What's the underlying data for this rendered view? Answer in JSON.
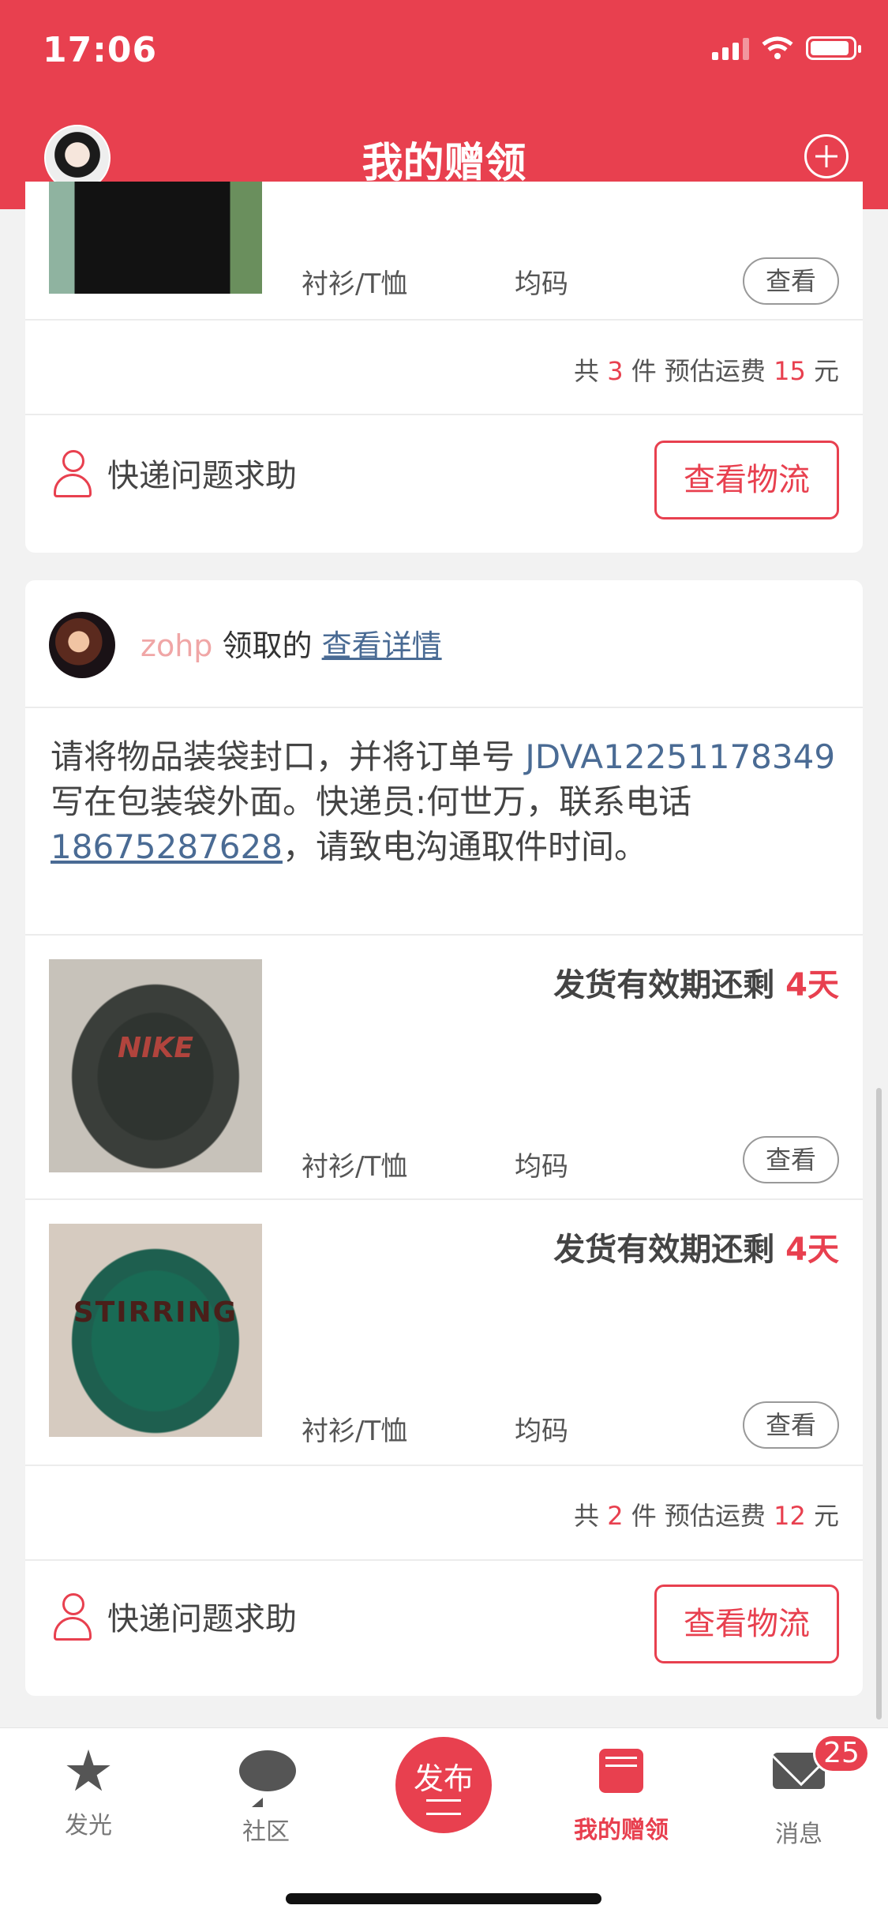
{
  "status_bar": {
    "time": "17:06"
  },
  "header": {
    "title": "我的赠领"
  },
  "order1": {
    "item": {
      "category": "衬衫/T恤",
      "size": "均码",
      "view_label": "查看"
    },
    "summary": {
      "prefix": "共",
      "count": "3",
      "unit": "件 预估运费",
      "fee": "15",
      "currency": "元"
    },
    "help_label": "快递问题求助",
    "logistics_label": "查看物流"
  },
  "order2": {
    "claimer": "zohp",
    "claim_text": "领取的",
    "details_link": "查看详情",
    "instructions": {
      "part1": "请将物品装袋封口，并将订单号 ",
      "code": "JDVA12251178349",
      "part2": " 写在包装袋外面。快递员:何世万，联系电话",
      "phone": "18675287628",
      "part3": "，请致电沟通取件时间。"
    },
    "items": [
      {
        "deadline_label": "发货有效期还剩",
        "deadline_days": "4天",
        "category": "衬衫/T恤",
        "size": "均码",
        "view_label": "查看",
        "print": "NIKE"
      },
      {
        "deadline_label": "发货有效期还剩",
        "deadline_days": "4天",
        "category": "衬衫/T恤",
        "size": "均码",
        "view_label": "查看",
        "print": "STIRRING"
      }
    ],
    "summary": {
      "prefix": "共",
      "count": "2",
      "unit": "件 预估运费",
      "fee": "12",
      "currency": "元"
    },
    "help_label": "快递问题求助",
    "logistics_label": "查看物流"
  },
  "tabbar": {
    "tabs": [
      {
        "label": "发光",
        "icon": "star-icon"
      },
      {
        "label": "社区",
        "icon": "chat-icon"
      },
      {
        "label": "发布",
        "icon": "publish-icon"
      },
      {
        "label": "我的赠领",
        "icon": "gift-book-icon",
        "active": true
      },
      {
        "label": "消息",
        "icon": "mail-icon"
      }
    ],
    "messages_badge": "25"
  },
  "colors": {
    "brand": "#e8404f",
    "link": "#4a6b94"
  }
}
